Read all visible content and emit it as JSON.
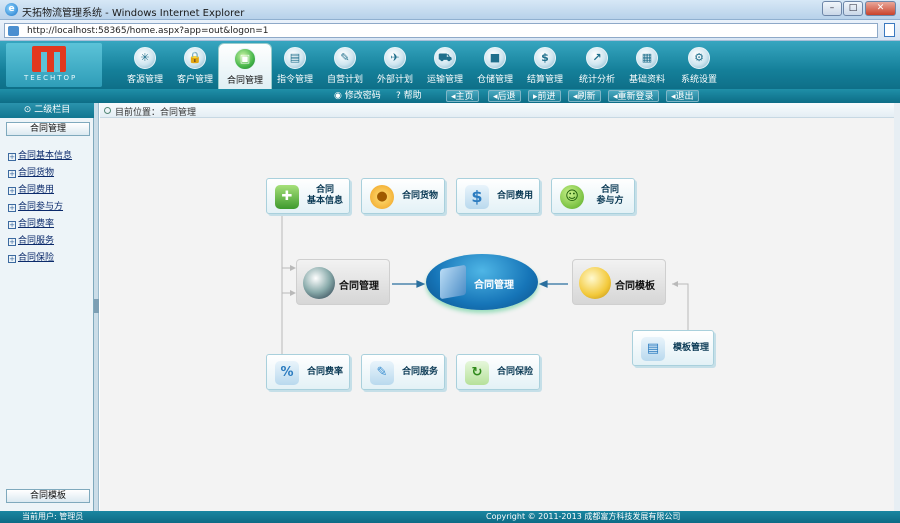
{
  "window": {
    "title": "天拓物流管理系统 - Windows Internet Explorer",
    "icon": "ie-icon"
  },
  "address": {
    "url": "http://localhost:58365/home.aspx?app=out&logon=1"
  },
  "logo": {
    "text": "TEECHTOP"
  },
  "nav": [
    {
      "label": "客源管理",
      "icon": "globe-icon"
    },
    {
      "label": "客户管理",
      "icon": "lock-icon"
    },
    {
      "label": "合同管理",
      "icon": "contract-icon",
      "active": true
    },
    {
      "label": "指令管理",
      "icon": "document-icon"
    },
    {
      "label": "自营计划",
      "icon": "edit-icon"
    },
    {
      "label": "外部计划",
      "icon": "compass-icon"
    },
    {
      "label": "运输管理",
      "icon": "truck-icon"
    },
    {
      "label": "仓储管理",
      "icon": "box-icon"
    },
    {
      "label": "结算管理",
      "icon": "dollar-icon"
    },
    {
      "label": "统计分析",
      "icon": "chart-icon"
    },
    {
      "label": "基础资料",
      "icon": "database-icon"
    },
    {
      "label": "系统设置",
      "icon": "settings-icon"
    }
  ],
  "toolbar": {
    "change_password": "修改密码",
    "help": "帮助",
    "buttons": [
      "主页",
      "后退",
      "前进",
      "刷新",
      "重新登录",
      "退出"
    ]
  },
  "sidebar": {
    "header": "二级栏目",
    "section": "合同管理",
    "items": [
      "合同基本信息",
      "合同货物",
      "合同费用",
      "合同参与方",
      "合同费率",
      "合同服务",
      "合同保险"
    ],
    "bottom": "合同模板"
  },
  "breadcrumb": "目前位置：合同管理",
  "diagram": {
    "top_cards": [
      {
        "label": "合同\n基本信息",
        "icon": "puzzle-icon",
        "color": "#4caf50"
      },
      {
        "label": "合同货物",
        "icon": "coin-icon",
        "color": "#f0a020"
      },
      {
        "label": "合同费用",
        "icon": "dollar-icon",
        "color": "#2c7cc0"
      },
      {
        "label": "合同\n参与方",
        "icon": "smiley-icon",
        "color": "#66bb33"
      }
    ],
    "bottom_cards": [
      {
        "label": "合同费率",
        "icon": "percent-icon",
        "color": "#2c7cc0"
      },
      {
        "label": "合同服务",
        "icon": "service-icon",
        "color": "#3a8ed0"
      },
      {
        "label": "合同保险",
        "icon": "refresh-icon",
        "color": "#55aa33"
      }
    ],
    "left_box": "合同管理",
    "hub": "合同管理",
    "right_box": "合同模板",
    "template_card": "模板管理"
  },
  "status": {
    "user": "当前用户: 管理员",
    "copyright": "Copyright © 2011-2013 成都富方科技发展有限公司"
  }
}
